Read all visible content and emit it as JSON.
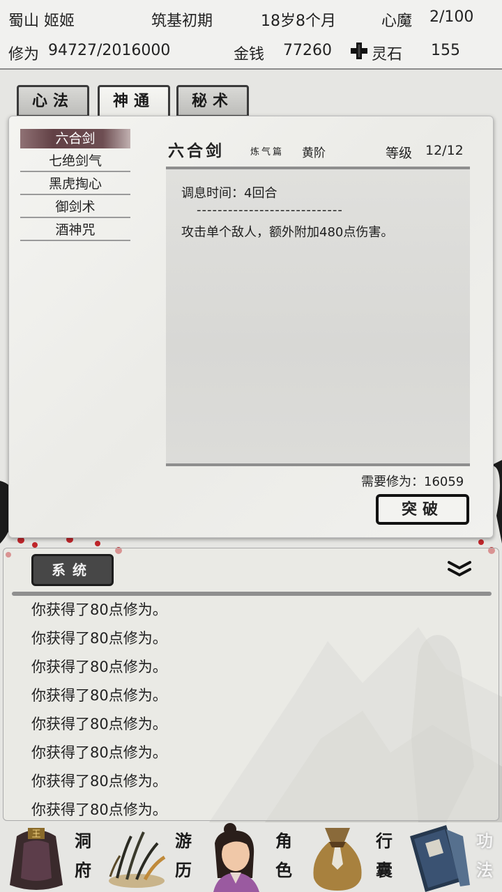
{
  "header": {
    "sect_name": "蜀山 姬姬",
    "realm": "筑基初期",
    "age": "18岁8个月",
    "heart_demon_label": "心魔",
    "heart_demon_value": "2/100",
    "cultivation_label": "修为",
    "cultivation_value": "94727/2016000",
    "money_label": "金钱",
    "money_value": "77260",
    "spirit_stone_label": "灵石",
    "spirit_stone_value": "155",
    "spirit_stone_icon": "cross-stone-icon"
  },
  "tabs": [
    {
      "label": "心法",
      "active": false
    },
    {
      "label": "神通",
      "active": true
    },
    {
      "label": "秘术",
      "active": false
    }
  ],
  "skills": [
    {
      "label": "六合剑",
      "selected": true
    },
    {
      "label": "七绝剑气",
      "selected": false
    },
    {
      "label": "黑虎掏心",
      "selected": false
    },
    {
      "label": "御剑术",
      "selected": false
    },
    {
      "label": "酒神咒",
      "selected": false
    }
  ],
  "detail": {
    "title": "六合剑",
    "chapter": "炼气篇",
    "grade": "黄阶",
    "level_label": "等级",
    "level_value": "12/12",
    "cooldown": "调息时间：4回合",
    "separator": "----------------------------",
    "effect": "攻击单个敌人，额外附加480点伤害。",
    "required": "需要修为：16059",
    "break_button": "突破"
  },
  "log": {
    "tab_label": "系统",
    "collapse_icon": "double-chevron-down-icon",
    "lines": [
      "你获得了80点修为。",
      "你获得了80点修为。",
      "你获得了80点修为。",
      "你获得了80点修为。",
      "你获得了80点修为。",
      "你获得了80点修为。",
      "你获得了80点修为。",
      "你获得了80点修为。"
    ]
  },
  "nav": [
    {
      "label": "洞府",
      "icon": "cave-bag-icon"
    },
    {
      "label": "游历",
      "icon": "grass-travel-icon"
    },
    {
      "label": "角色",
      "icon": "character-portrait-icon"
    },
    {
      "label": "行囊",
      "icon": "pouch-icon"
    },
    {
      "label": "功法",
      "icon": "scroll-books-icon"
    }
  ],
  "colors": {
    "panel_bg": "#f0f0ed",
    "selected_skill": "#5e3c41",
    "log_tab_bg": "#474747",
    "plum_blossom": "#c0262b"
  }
}
